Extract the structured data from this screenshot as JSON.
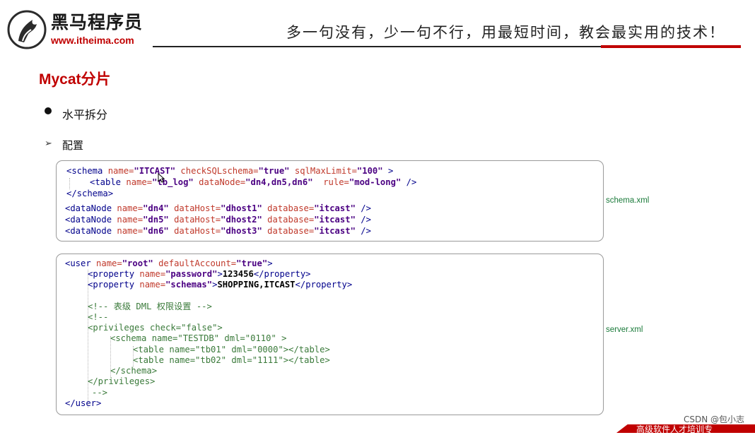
{
  "header": {
    "brand_name": "黑马程序员",
    "brand_url": "www.itheima.com",
    "slogan": "多一句没有，少一句不行，用最短时间，教会最实用的技术！"
  },
  "slide": {
    "title": "Mycat分片",
    "bullet": "水平拆分",
    "sub_bullet": "配置"
  },
  "schema_xml": {
    "label": "schema.xml",
    "line1": {
      "open": "<schema ",
      "a1": "name=",
      "v1": "\"ITCAST\"",
      "a2": " checkSQLschema=",
      "v2": "\"true\"",
      "a3": " sqlMaxLimit=",
      "v3": "\"100\"",
      "close": " >"
    },
    "line2": {
      "open": "<table ",
      "a1": "name=",
      "v1": "\"tb_log\"",
      "a2": " dataNode=",
      "v2": "\"dn4,dn5,dn6\"",
      "a3": "  rule=",
      "v3": "\"mod-long\"",
      "close": " />"
    },
    "line3": "</schema>",
    "datanodes": [
      {
        "open": "<dataNode ",
        "a1": "name=",
        "v1": "\"dn4\"",
        "a2": " dataHost=",
        "v2": "\"dhost1\"",
        "a3": " database=",
        "v3": "\"itcast\"",
        "close": " />"
      },
      {
        "open": "<dataNode ",
        "a1": "name=",
        "v1": "\"dn5\"",
        "a2": " dataHost=",
        "v2": "\"dhost2\"",
        "a3": " database=",
        "v3": "\"itcast\"",
        "close": " />"
      },
      {
        "open": "<dataNode ",
        "a1": "name=",
        "v1": "\"dn6\"",
        "a2": " dataHost=",
        "v2": "\"dhost3\"",
        "a3": " database=",
        "v3": "\"itcast\"",
        "close": " />"
      }
    ]
  },
  "server_xml": {
    "label": "server.xml",
    "l1": {
      "open": "<user ",
      "a1": "name=",
      "v1": "\"root\"",
      "a2": " defaultAccount=",
      "v2": "\"true\"",
      "close": ">"
    },
    "l2": {
      "open": "<property ",
      "a1": "name=",
      "v1": "\"password\"",
      "mid": ">",
      "text": "123456",
      "close": "</property>"
    },
    "l3": {
      "open": "<property ",
      "a1": "name=",
      "v1": "\"schemas\"",
      "mid": ">",
      "text": "SHOPPING,ITCAST",
      "close": "</property>"
    },
    "l4": "<!-- 表级 DML 权限设置 -->",
    "l5": "<!--",
    "l6": "<privileges check=\"false\">",
    "l7": "<schema name=\"TESTDB\" dml=\"0110\" >",
    "l8": "<table name=\"tb01\" dml=\"0000\"></table>",
    "l9": "<table name=\"tb02\" dml=\"1111\"></table>",
    "l10": "</schema>",
    "l11": "</privileges>",
    "l12": "-->",
    "l13": "</user>"
  },
  "footer": {
    "watermark": "CSDN @包小志",
    "banner": "高级软件人才培训专"
  },
  "colors": {
    "accent_red": "#c00000",
    "tag_blue": "#00008b",
    "attr_red": "#c0392b",
    "value_purple": "#4b0082",
    "comment_green": "#3a7a3a",
    "label_green": "#1a7a3a"
  }
}
